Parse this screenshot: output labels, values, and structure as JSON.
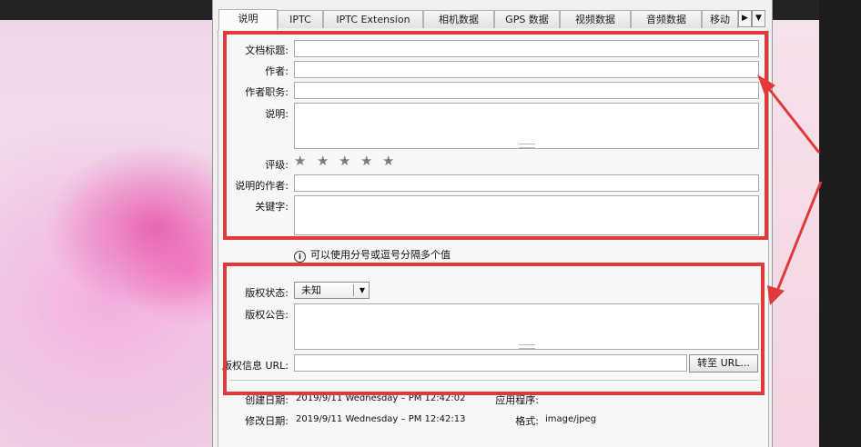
{
  "tabs": [
    {
      "label": "说明",
      "active": true
    },
    {
      "label": "IPTC"
    },
    {
      "label": "IPTC Extension"
    },
    {
      "label": "相机数据"
    },
    {
      "label": "GPS 数据"
    },
    {
      "label": "视频数据"
    },
    {
      "label": "音频数据"
    },
    {
      "label": "移动"
    }
  ],
  "fields": {
    "doc_title_label": "文档标题:",
    "author_label": "作者:",
    "author_title_label": "作者职务:",
    "description_label": "说明:",
    "rating_label": "评级:",
    "rating_value": 0,
    "rating_max": 5,
    "desc_writer_label": "说明的作者:",
    "keywords_label": "关键字:"
  },
  "hint": "可以使用分号或逗号分隔多个值",
  "copyright": {
    "status_label": "版权状态:",
    "status_value": "未知",
    "notice_label": "版权公告:",
    "url_label": "版权信息 URL:",
    "goto_button": "转至 URL..."
  },
  "info": {
    "created_label": "创建日期:",
    "created_value": "2019/9/11 Wednesday – PM 12:42:02",
    "app_label": "应用程序:",
    "modified_label": "修改日期:",
    "modified_value": "2019/9/11 Wednesday – PM 12:42:13",
    "format_label": "格式:",
    "format_value": "image/jpeg"
  },
  "colors": {
    "annotation_red": "#e23a3a"
  }
}
